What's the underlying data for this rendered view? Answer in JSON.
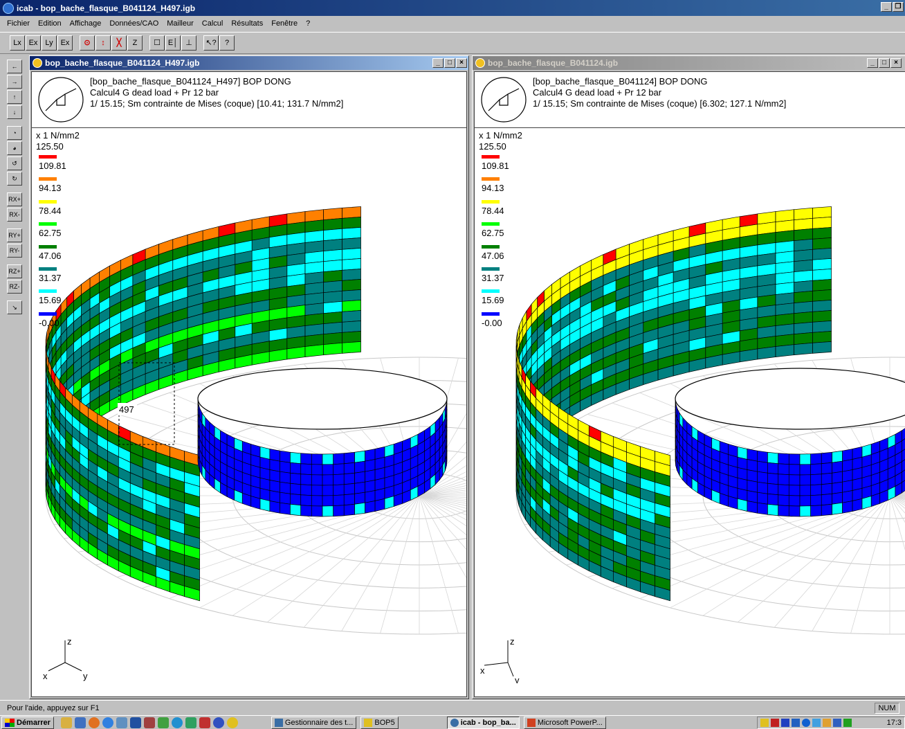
{
  "app": {
    "title": "icab - bop_bache_flasque_B041124_H497.igb",
    "window_buttons": [
      "_",
      "❐"
    ]
  },
  "menu": [
    "Fichier",
    "Edition",
    "Affichage",
    "Données/CAO",
    "Mailleur",
    "Calcul",
    "Résultats",
    "Fenêtre",
    "?"
  ],
  "toolbar_groups": [
    [
      "Lx",
      "Ex",
      "Ly",
      "Ex"
    ],
    [
      "⊙",
      "↕",
      "╳",
      "Z"
    ],
    [
      "☐",
      "E│",
      "⊥"
    ],
    [
      "↖?",
      "?"
    ]
  ],
  "left_toolbar": [
    "←",
    "→",
    "↑",
    "↓",
    "◔",
    "◕",
    "↺",
    "↻",
    "RX+",
    "RX-",
    "RY+",
    "RY-",
    "RZ+",
    "RZ-",
    "↘"
  ],
  "windows": [
    {
      "title": "bop_bache_flasque_B041124_H497.igb",
      "active": true,
      "buttons": [
        "_",
        "□",
        "×"
      ],
      "header_lines": [
        "[bop_bache_flasque_B041124_H497] BOP DONG",
        "Calcul4 G dead load + Pr 12 bar",
        "1/ 15.15; Sm  contrainte de Mises (coque) [10.41; 131.7 N/mm2]"
      ],
      "node_label": "497",
      "axes": {
        "z": "z",
        "x": "x",
        "y": "y"
      }
    },
    {
      "title": "bop_bache_flasque_B041124.igb",
      "active": false,
      "buttons": [
        "_",
        "□",
        "×"
      ],
      "header_lines": [
        "[bop_bache_flasque_B041124] BOP DONG",
        "Calcul4 G dead load + Pr 12 bar",
        "1/ 15.15; Sm  contrainte de Mises (coque) [6.302; 127.1 N/mm2]"
      ],
      "node_label": "",
      "axes": {
        "z": "z",
        "x": "x",
        "y": "y"
      }
    }
  ],
  "legend": {
    "unit": "x 1 N/mm2",
    "top": "125.50",
    "levels": [
      {
        "value": "109.81",
        "color": "#ff0000"
      },
      {
        "value": "94.13",
        "color": "#ff8000"
      },
      {
        "value": "78.44",
        "color": "#ffff00"
      },
      {
        "value": "62.75",
        "color": "#00ff00"
      },
      {
        "value": "47.06",
        "color": "#008000"
      },
      {
        "value": "31.37",
        "color": "#008080"
      },
      {
        "value": "15.69",
        "color": "#00ffff"
      },
      {
        "value": "-0.00",
        "color": "#0000ff"
      }
    ]
  },
  "status": {
    "help": "Pour l'aide, appuyez sur F1",
    "num": "NUM"
  },
  "taskbar": {
    "start": "Démarrer",
    "tasks": [
      {
        "label": "Gestionnaire des t...",
        "active": false
      },
      {
        "label": "BOP5",
        "active": false
      },
      {
        "label": "icab - bop_ba...",
        "active": true
      },
      {
        "label": "Microsoft PowerP...",
        "active": false
      }
    ],
    "clock": "17:3"
  }
}
